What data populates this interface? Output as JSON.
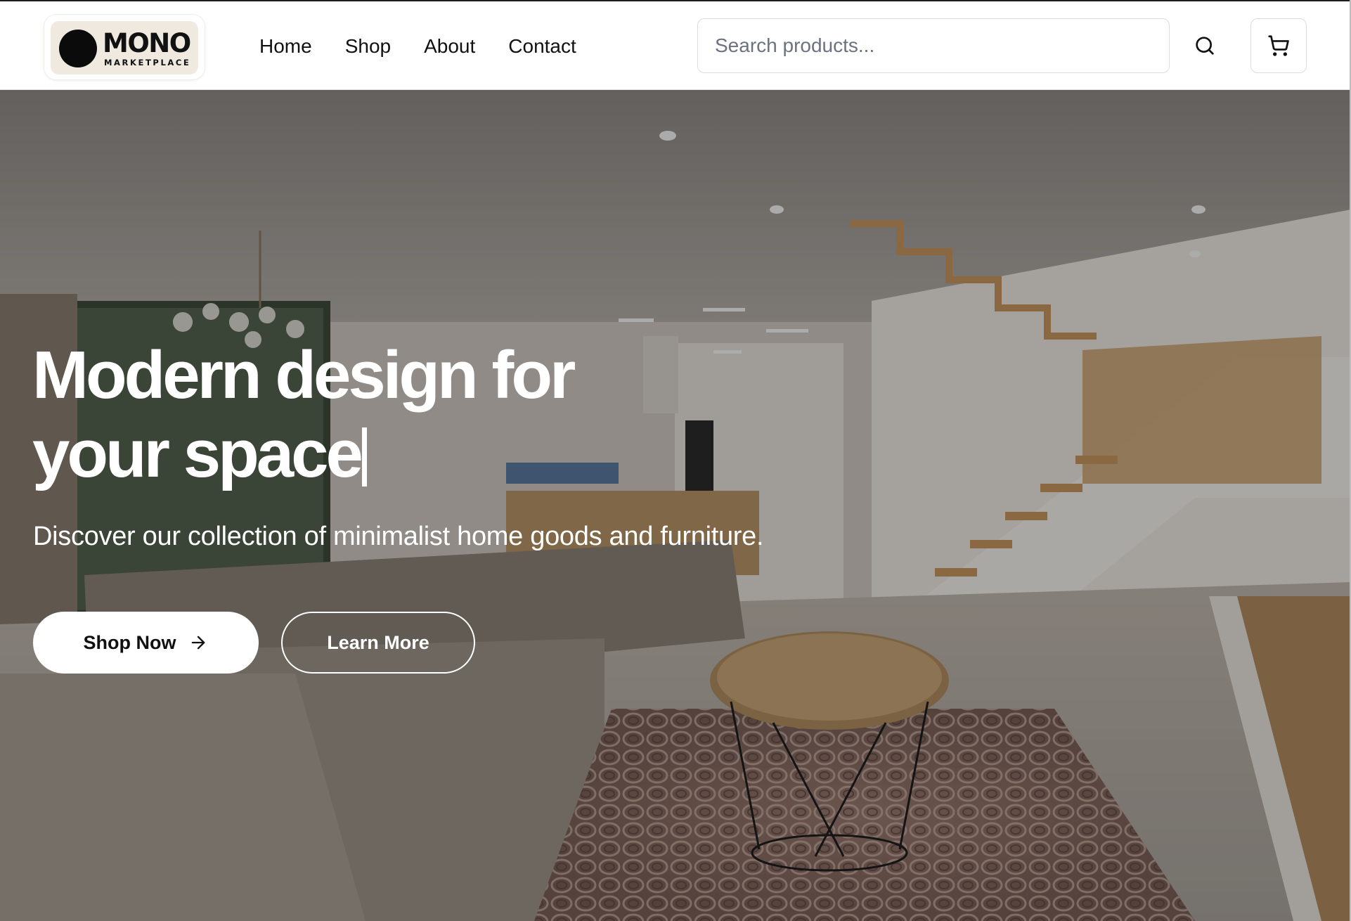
{
  "brand": {
    "name": "MONO",
    "tagline": "MARKETPLACE"
  },
  "nav": {
    "items": [
      {
        "label": "Home"
      },
      {
        "label": "Shop"
      },
      {
        "label": "About"
      },
      {
        "label": "Contact"
      }
    ]
  },
  "search": {
    "placeholder": "Search products...",
    "value": "",
    "icon": "search-icon"
  },
  "cart": {
    "icon": "cart-icon"
  },
  "hero": {
    "title_line1": "Modern design for",
    "title_line2": "your space",
    "subtitle": "Discover our collection of minimalist home goods and furniture.",
    "primary_button": {
      "label": "Shop Now",
      "icon": "arrow-right-icon"
    },
    "secondary_button": {
      "label": "Learn More"
    },
    "image": "interior-living-room-staircase"
  },
  "colors": {
    "text": "#111111",
    "overlay": "rgba(0,0,0,0.30)",
    "logo_bg": "#efe9e0",
    "border": "#dcdcdc"
  }
}
